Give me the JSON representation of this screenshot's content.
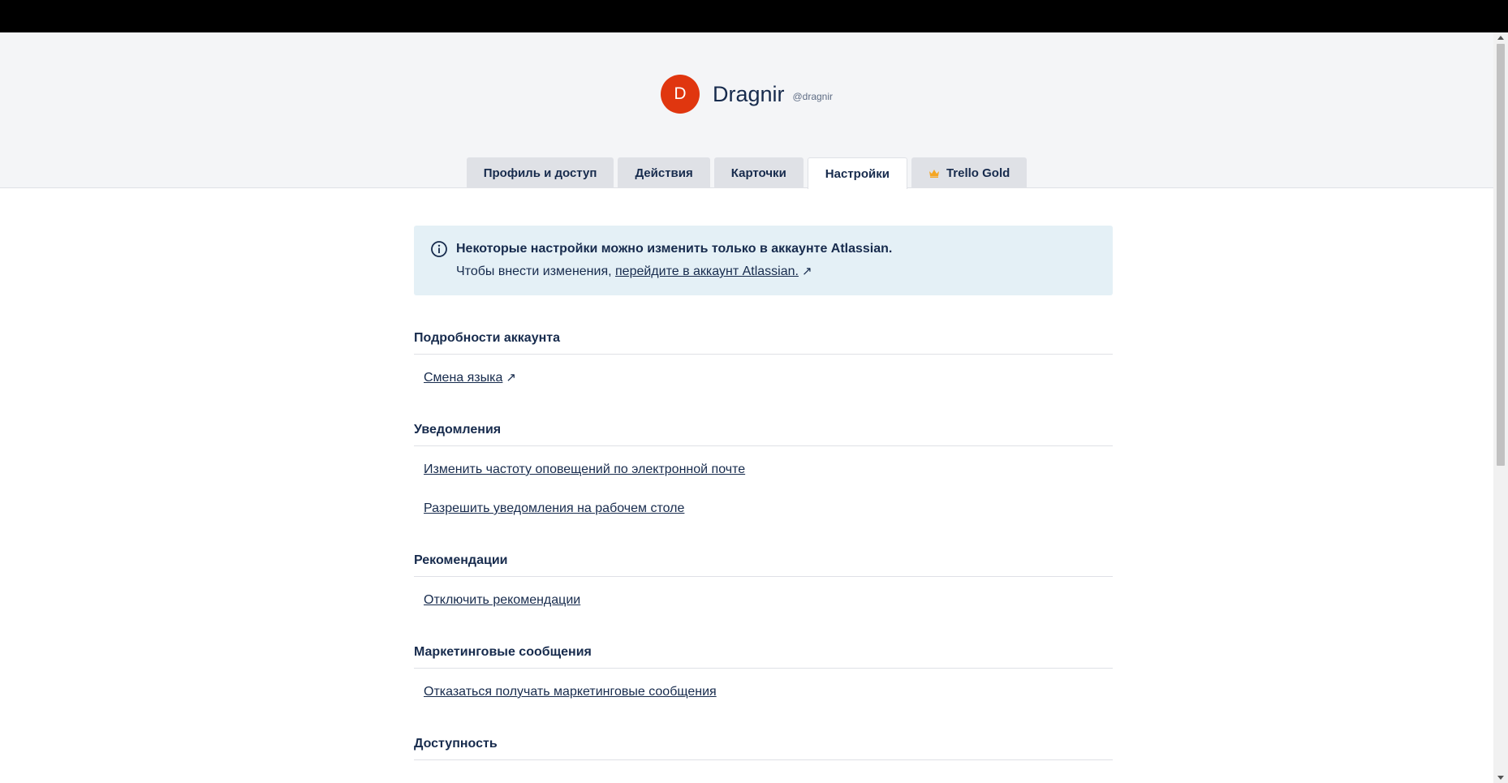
{
  "profile": {
    "avatar_initial": "D",
    "full_name": "Dragnir",
    "username": "@dragnir"
  },
  "tabs": [
    {
      "label": "Профиль и доступ"
    },
    {
      "label": "Действия"
    },
    {
      "label": "Карточки"
    },
    {
      "label": "Настройки",
      "active": true
    },
    {
      "label": "Trello Gold",
      "icon": "crown-icon"
    }
  ],
  "banner": {
    "icon": "info-icon",
    "title": "Некоторые настройки можно изменить только в аккаунте Atlassian.",
    "text_prefix": "Чтобы внести изменения, ",
    "link": "перейдите в аккаунт Atlassian.",
    "link_icon": "↗"
  },
  "sections": {
    "account": {
      "title": "Подробности аккаунта",
      "change_language": "Смена языка",
      "external_icon": "↗"
    },
    "notifications": {
      "title": "Уведомления",
      "email_frequency": "Изменить частоту оповещений по электронной почте",
      "desktop": "Разрешить уведомления на рабочем столе"
    },
    "recommendations": {
      "title": "Рекомендации",
      "disable": "Отключить рекомендации"
    },
    "marketing": {
      "title": "Маркетинговые сообщения",
      "unsubscribe": "Отказаться получать маркетинговые сообщения"
    },
    "accessibility": {
      "title": "Доступность"
    }
  },
  "colors": {
    "avatar_bg": "#e0360f",
    "crown": "#f5a623",
    "banner_bg": "#e4f0f6",
    "header_bg": "#f4f5f7",
    "text": "#172b4d"
  }
}
